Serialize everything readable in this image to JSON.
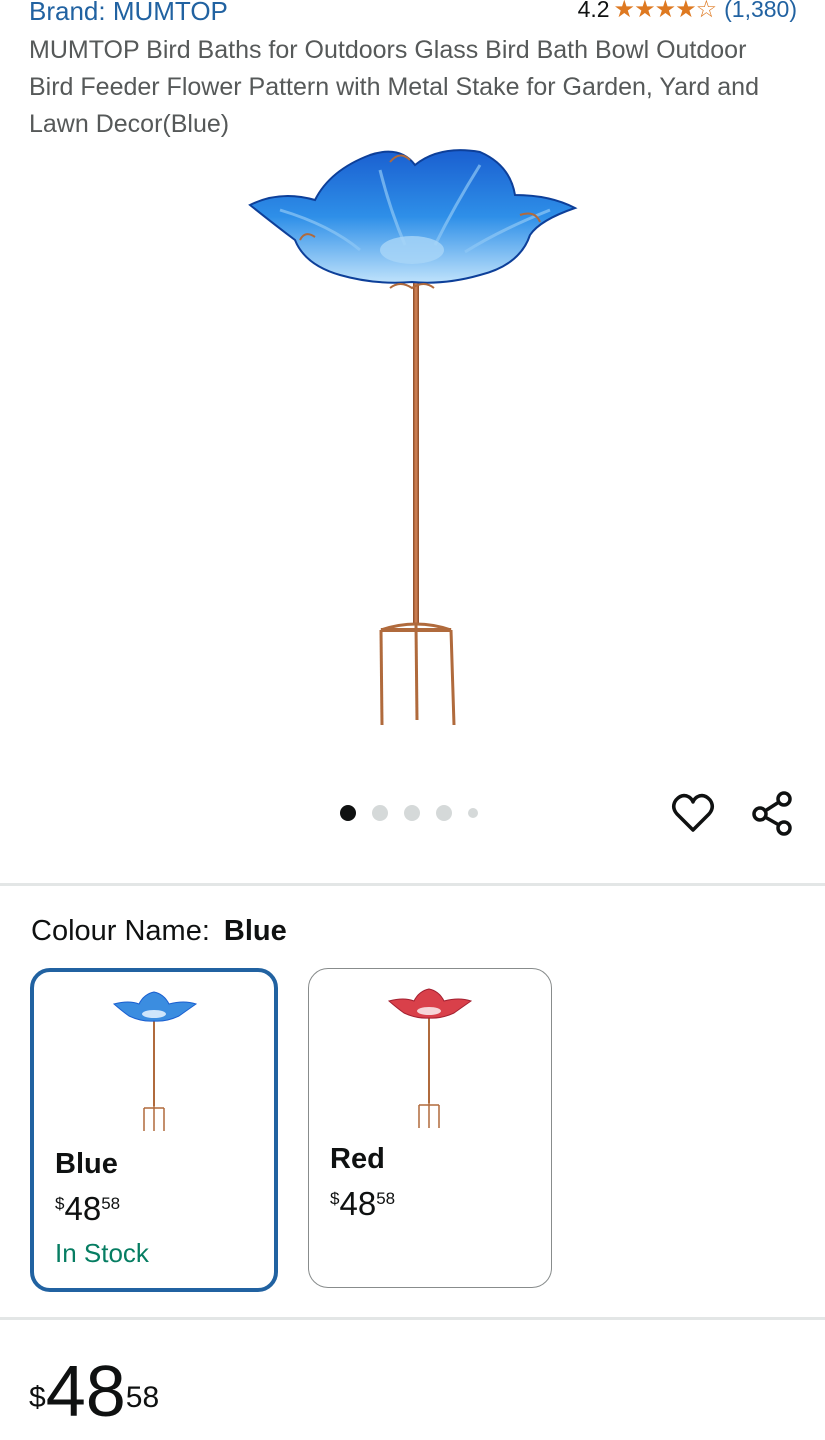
{
  "header": {
    "brand": "Brand: MUMTOP",
    "rating_value": "4.2",
    "rating": 4.2,
    "review_count": "(1,380)"
  },
  "product": {
    "title": "MUMTOP Bird Baths for Outdoors Glass Bird Bath Bowl Outdoor Bird Feeder Flower Pattern with Metal Stake for Garden, Yard and Lawn Decor(Blue)",
    "image_icon": "bird-bath-blue-image"
  },
  "carousel": {
    "dot_count": 5,
    "active_index": 0
  },
  "actions": {
    "wishlist_icon": "heart-icon",
    "share_icon": "share-icon"
  },
  "colour": {
    "label": "Colour Name:",
    "selected": "Blue",
    "options": [
      {
        "name": "Blue",
        "currency": "$",
        "whole": "48",
        "fraction": "58",
        "stock": "In Stock",
        "selected": true,
        "color": "#3b8de0"
      },
      {
        "name": "Red",
        "currency": "$",
        "whole": "48",
        "fraction": "58",
        "stock": "",
        "selected": false,
        "color": "#d9404a"
      }
    ]
  },
  "price": {
    "currency": "$",
    "whole": "48",
    "fraction": "58"
  },
  "colors": {
    "link": "#2162a1",
    "star": "#de7921",
    "in_stock": "#067d62",
    "selected_border": "#2162a1"
  }
}
